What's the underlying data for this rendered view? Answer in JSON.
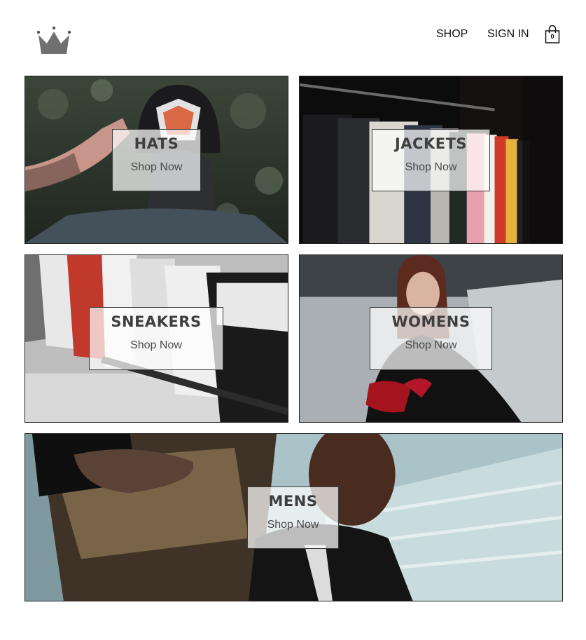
{
  "header": {
    "logo_icon": "crown-icon",
    "nav": [
      {
        "label": "SHOP"
      },
      {
        "label": "SIGN IN"
      }
    ],
    "cart": {
      "icon": "shopping-bag-icon",
      "count": "0"
    }
  },
  "categories": [
    {
      "title": "HATS",
      "cta": "Shop Now"
    },
    {
      "title": "JACKETS",
      "cta": "Shop Now"
    },
    {
      "title": "SNEAKERS",
      "cta": "Shop Now"
    },
    {
      "title": "WOMENS",
      "cta": "Shop Now"
    },
    {
      "title": "MENS",
      "cta": "Shop Now"
    }
  ],
  "colors": {
    "text": "#111111",
    "label_text": "#3f3f3f",
    "crown": "#6f6f6f",
    "tile_border": "#222222"
  }
}
